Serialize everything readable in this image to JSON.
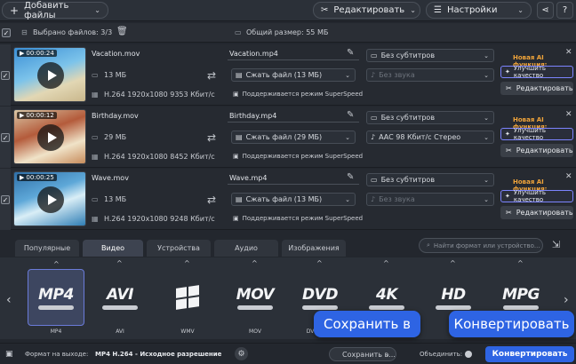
{
  "toolbar": {
    "add_files": "Добавить файлы",
    "edit": "Редактировать",
    "settings": "Настройки"
  },
  "selection": {
    "selected_label": "Выбрано файлов: 3/3",
    "total_size": "Общий размер: 55 МБ"
  },
  "files": [
    {
      "duration": "00:00:24",
      "name": "Vacation.mov",
      "size": "13 МБ",
      "info": "H.264 1920x1080 9353 Кбит/с",
      "output_name": "Vacation.mp4",
      "compress": "Сжать файл (13 МБ)",
      "subtitles": "Без субтитров",
      "audio": "Без звука",
      "audio_disabled": true,
      "superspeed": "Поддерживается режим SuperSpeed",
      "ai_label": "Новая AI функция:",
      "ai_button": "Улучшить качество",
      "edit_button": "Редактировать"
    },
    {
      "duration": "00:00:12",
      "name": "Birthday.mov",
      "size": "29 МБ",
      "info": "H.264 1920x1080 8452 Кбит/с",
      "output_name": "Birthday.mp4",
      "compress": "Сжать файл (29 МБ)",
      "subtitles": "Без субтитров",
      "audio": "AAC 98 Кбит/с Стерео",
      "audio_disabled": false,
      "superspeed": "Поддерживается режим SuperSpeed",
      "ai_label": "Новая AI функция:",
      "ai_button": "Улучшить качество",
      "edit_button": "Редактировать"
    },
    {
      "duration": "00:00:25",
      "name": "Wave.mov",
      "size": "13 МБ",
      "info": "H.264 1920x1080 9248 Кбит/с",
      "output_name": "Wave.mp4",
      "compress": "Сжать файл (13 МБ)",
      "subtitles": "Без субтитров",
      "audio": "Без звука",
      "audio_disabled": true,
      "superspeed": "Поддерживается режим SuperSpeed",
      "ai_label": "Новая AI функция:",
      "ai_button": "Улучшить качество",
      "edit_button": "Редактировать"
    }
  ],
  "tabs": [
    "Популярные",
    "Видео",
    "Устройства",
    "Аудио",
    "Изображения"
  ],
  "active_tab": "Видео",
  "search": {
    "placeholder": "Найти формат или устройство..."
  },
  "formats": [
    {
      "big": "MP4",
      "label": "MP4",
      "active": true
    },
    {
      "big": "AVI",
      "label": "AVI",
      "active": false
    },
    {
      "big": "win",
      "label": "WMV",
      "active": false
    },
    {
      "big": "MOV",
      "label": "MOV",
      "active": false
    },
    {
      "big": "DVD",
      "label": "DVD-совм",
      "active": false
    },
    {
      "big": "4K",
      "label": "",
      "active": false
    },
    {
      "big": "HD",
      "label": "",
      "active": false
    },
    {
      "big": "MPG",
      "label": "",
      "active": false
    }
  ],
  "bottom": {
    "output_format_label": "Формат на выходе:",
    "output_format_value": "MP4 H.264 - Исходное разрешение",
    "save_to": "Сохранить в...",
    "merge": "Объединить:",
    "convert": "Конвертировать"
  },
  "tooltips": {
    "save": "Сохранить в",
    "convert": "Конвертировать"
  },
  "colors": {
    "accent": "#2e64e3",
    "ai_label": "#f0a43a",
    "background": "#23272e"
  }
}
